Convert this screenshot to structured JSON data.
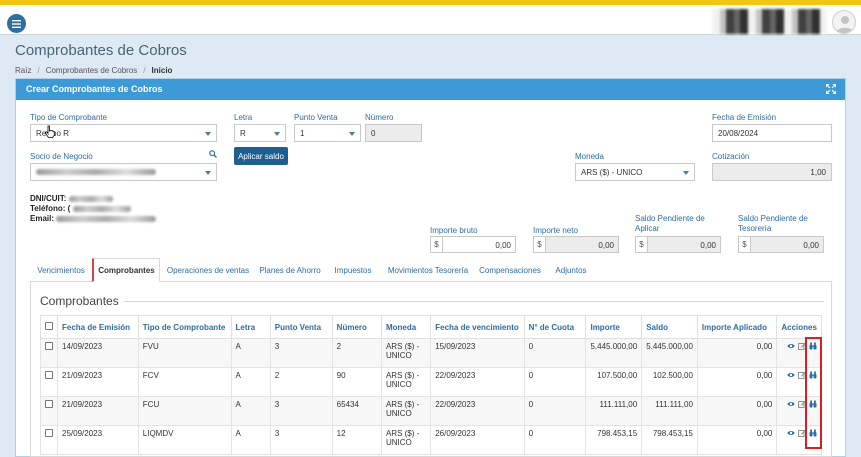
{
  "page": {
    "title": "Comprobantes de Cobros"
  },
  "breadcrumb": [
    "Raíz",
    "Comprobantes de Cobros",
    "Inicio"
  ],
  "panel": {
    "title": "Crear Comprobantes de Cobros"
  },
  "form": {
    "tipo_label": "Tipo de Comprobante",
    "tipo_value": "Recibo R",
    "letra_label": "Letra",
    "letra_value": "R",
    "punto_label": "Punto Venta",
    "punto_value": "1",
    "numero_label": "Número",
    "numero_value": "0",
    "fecha_label": "Fecha de Emisión",
    "fecha_value": "20/08/2024",
    "socio_label": "Socio de Negocio",
    "aplicar_label": "Aplicar saldo",
    "moneda_label": "Moneda",
    "moneda_value": "ARS ($) - UNICO",
    "cotizacion_label": "Cotización",
    "cotizacion_value": "1,00"
  },
  "info": {
    "dni_label": "DNI/CUIT:",
    "tel_label": "Teléfono: (",
    "email_label": "Email:"
  },
  "amounts": {
    "bruto_label": "Importe bruto",
    "neto_label": "Importe neto",
    "pend_aplicar_label": "Saldo Pendiente de Aplicar",
    "pend_tesoreria_label": "Saldo Pendiente de Tesorería",
    "currency_symbol": "$",
    "bruto_value": "0,00",
    "neto_value": "0,00",
    "pend_aplicar_value": "0,00",
    "pend_tesoreria_value": "0,00"
  },
  "tabs": [
    "Vencimientos",
    "Comprobantes",
    "Operaciones de ventas",
    "Planes de Ahorro",
    "Impuestos",
    "Movimientos Tesorería",
    "Compensaciones",
    "Adjuntos"
  ],
  "section": {
    "title": "Comprobantes"
  },
  "table": {
    "headers": [
      "Fecha de Emisión",
      "Tipo de Comprobante",
      "Letra",
      "Punto Venta",
      "Número",
      "Moneda",
      "Fecha de vencimiento",
      "N° de Cuota",
      "Importe",
      "Saldo",
      "Importe Aplicado",
      "Acciones"
    ],
    "rows": [
      [
        "14/09/2023",
        "FVU",
        "A",
        "3",
        "2",
        "ARS ($) - UNICO",
        "15/09/2023",
        "0",
        "5.445.000,00",
        "5.445.000,00",
        "0,00"
      ],
      [
        "21/09/2023",
        "FCV",
        "A",
        "2",
        "90",
        "ARS ($) - UNICO",
        "22/09/2023",
        "0",
        "107.500,00",
        "102.500,00",
        "0,00"
      ],
      [
        "21/09/2023",
        "FCU",
        "A",
        "3",
        "65434",
        "ARS ($) - UNICO",
        "22/09/2023",
        "0",
        "111.111,00",
        "111.111,00",
        "0,00"
      ],
      [
        "25/09/2023",
        "LIQMDV",
        "A",
        "3",
        "12",
        "ARS ($) - UNICO",
        "26/09/2023",
        "0",
        "798.453,15",
        "798.453,15",
        "0,00"
      ]
    ]
  },
  "icons": {
    "menu": "hamburger-menu-icon",
    "expand": "expand-icon",
    "search": "search-icon",
    "view": "eye-icon",
    "edit": "edit-icon",
    "detail": "binoculars-icon"
  },
  "colors": {
    "accent": "#3d9ad6",
    "topstrip": "#f3c613",
    "highlight": "#d62020"
  }
}
